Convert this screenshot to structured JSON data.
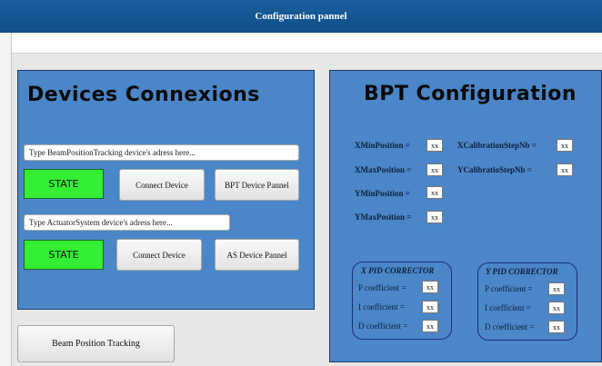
{
  "window": {
    "title": "Configuration pannel"
  },
  "devices": {
    "title": "Devices Connexions",
    "bpt_address_placeholder": "Type BeamPositionTracking device's adress here...",
    "bpt_state": "STATE",
    "bpt_connect": "Connect Device",
    "bpt_panel": "BPT Device Pannel",
    "as_address_placeholder": "Type ActuatorSystem device's adress here...",
    "as_state": "STATE",
    "as_connect": "Connect Device",
    "as_panel": "AS Device Pannel",
    "state_color": "#33ee33"
  },
  "bottom_button": "Beam Position Tracking",
  "bpt_config": {
    "title": "BPT Configuration",
    "xmin_label": "XMinPosition =",
    "xmin_value": "xx",
    "xmax_label": "XMaxPosition =",
    "xmax_value": "xx",
    "ymin_label": "YMinPosition =",
    "ymin_value": "xx",
    "ymax_label": "YMaxPosition =",
    "ymax_value": "xx",
    "xcal_label": "XCalibrationStepNb =",
    "xcal_value": "xx",
    "ycal_label": "YCalibratioStepNb =",
    "ycal_value": "xx"
  },
  "x_pid": {
    "title": "X PID CORRECTOR",
    "p_label": "P coefficient =",
    "p_value": "xx",
    "i_label": "I coefficient =",
    "i_value": "xx",
    "d_label": "D coefficient =",
    "d_value": "xx"
  },
  "y_pid": {
    "title": "Y PID CORRECTOR",
    "p_label": "P coefficient =",
    "p_value": "xx",
    "i_label": "I coefficient =",
    "i_value": "xx",
    "d_label": "D coefficient =",
    "d_value": "xx"
  },
  "colors": {
    "panel_blue": "#4a86c8",
    "title_bar": "#0f4e8a"
  }
}
